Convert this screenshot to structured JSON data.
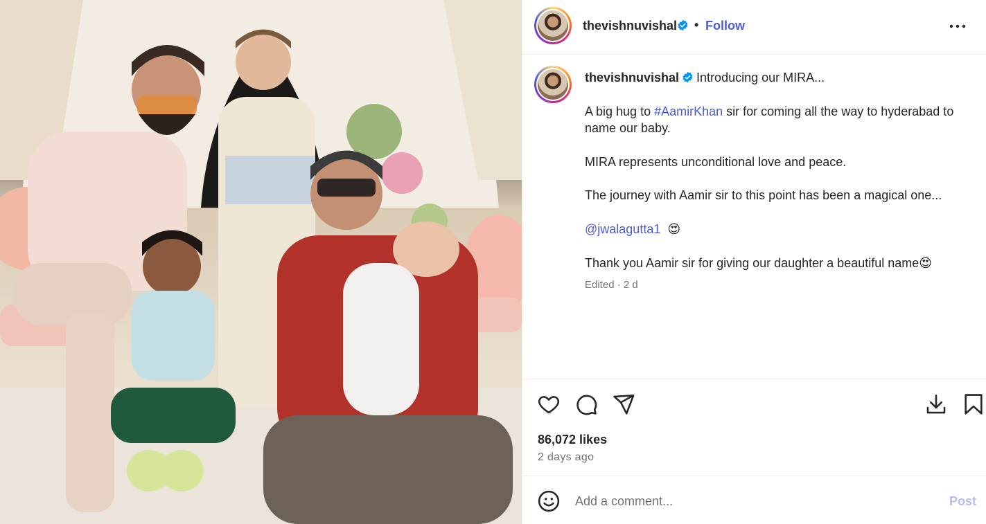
{
  "post": {
    "image_alt": "Group photo",
    "username": "thevishnuvishal",
    "separator": "•",
    "follow_label": "Follow",
    "more_icon": "more-horizontal-icon"
  },
  "caption": {
    "username": "thevishnuvishal",
    "line1": "Introducing our MIRA...",
    "para1_prefix": "A big hug to ",
    "hashtag": "#AamirKhan",
    "para1_suffix": " sir for coming all the way to hyderabad to name our baby.",
    "para2": "MIRA represents unconditional love and peace.",
    "para3": "The journey with Aamir sir to this point has been a magical one...",
    "mention": "@jwalagutta1",
    "mention_emoji": "😍",
    "para4": "Thank you Aamir sir for giving our daughter a beautiful name",
    "para4_emoji": "😍",
    "meta": "Edited · 2 d"
  },
  "actions": {
    "like_icon": "heart-icon",
    "comment_icon": "comment-icon",
    "share_icon": "send-icon",
    "download_icon": "download-icon",
    "save_icon": "bookmark-icon",
    "likes": "86,072 likes",
    "posted": "2 days ago"
  },
  "comment": {
    "emoji_icon": "smiley-icon",
    "placeholder": "Add a comment...",
    "post_label": "Post"
  },
  "colors": {
    "link_blue": "#4a5cd6",
    "verified_blue": "#0095f6",
    "muted": "#737373",
    "post_disabled": "#b3bdf0"
  }
}
